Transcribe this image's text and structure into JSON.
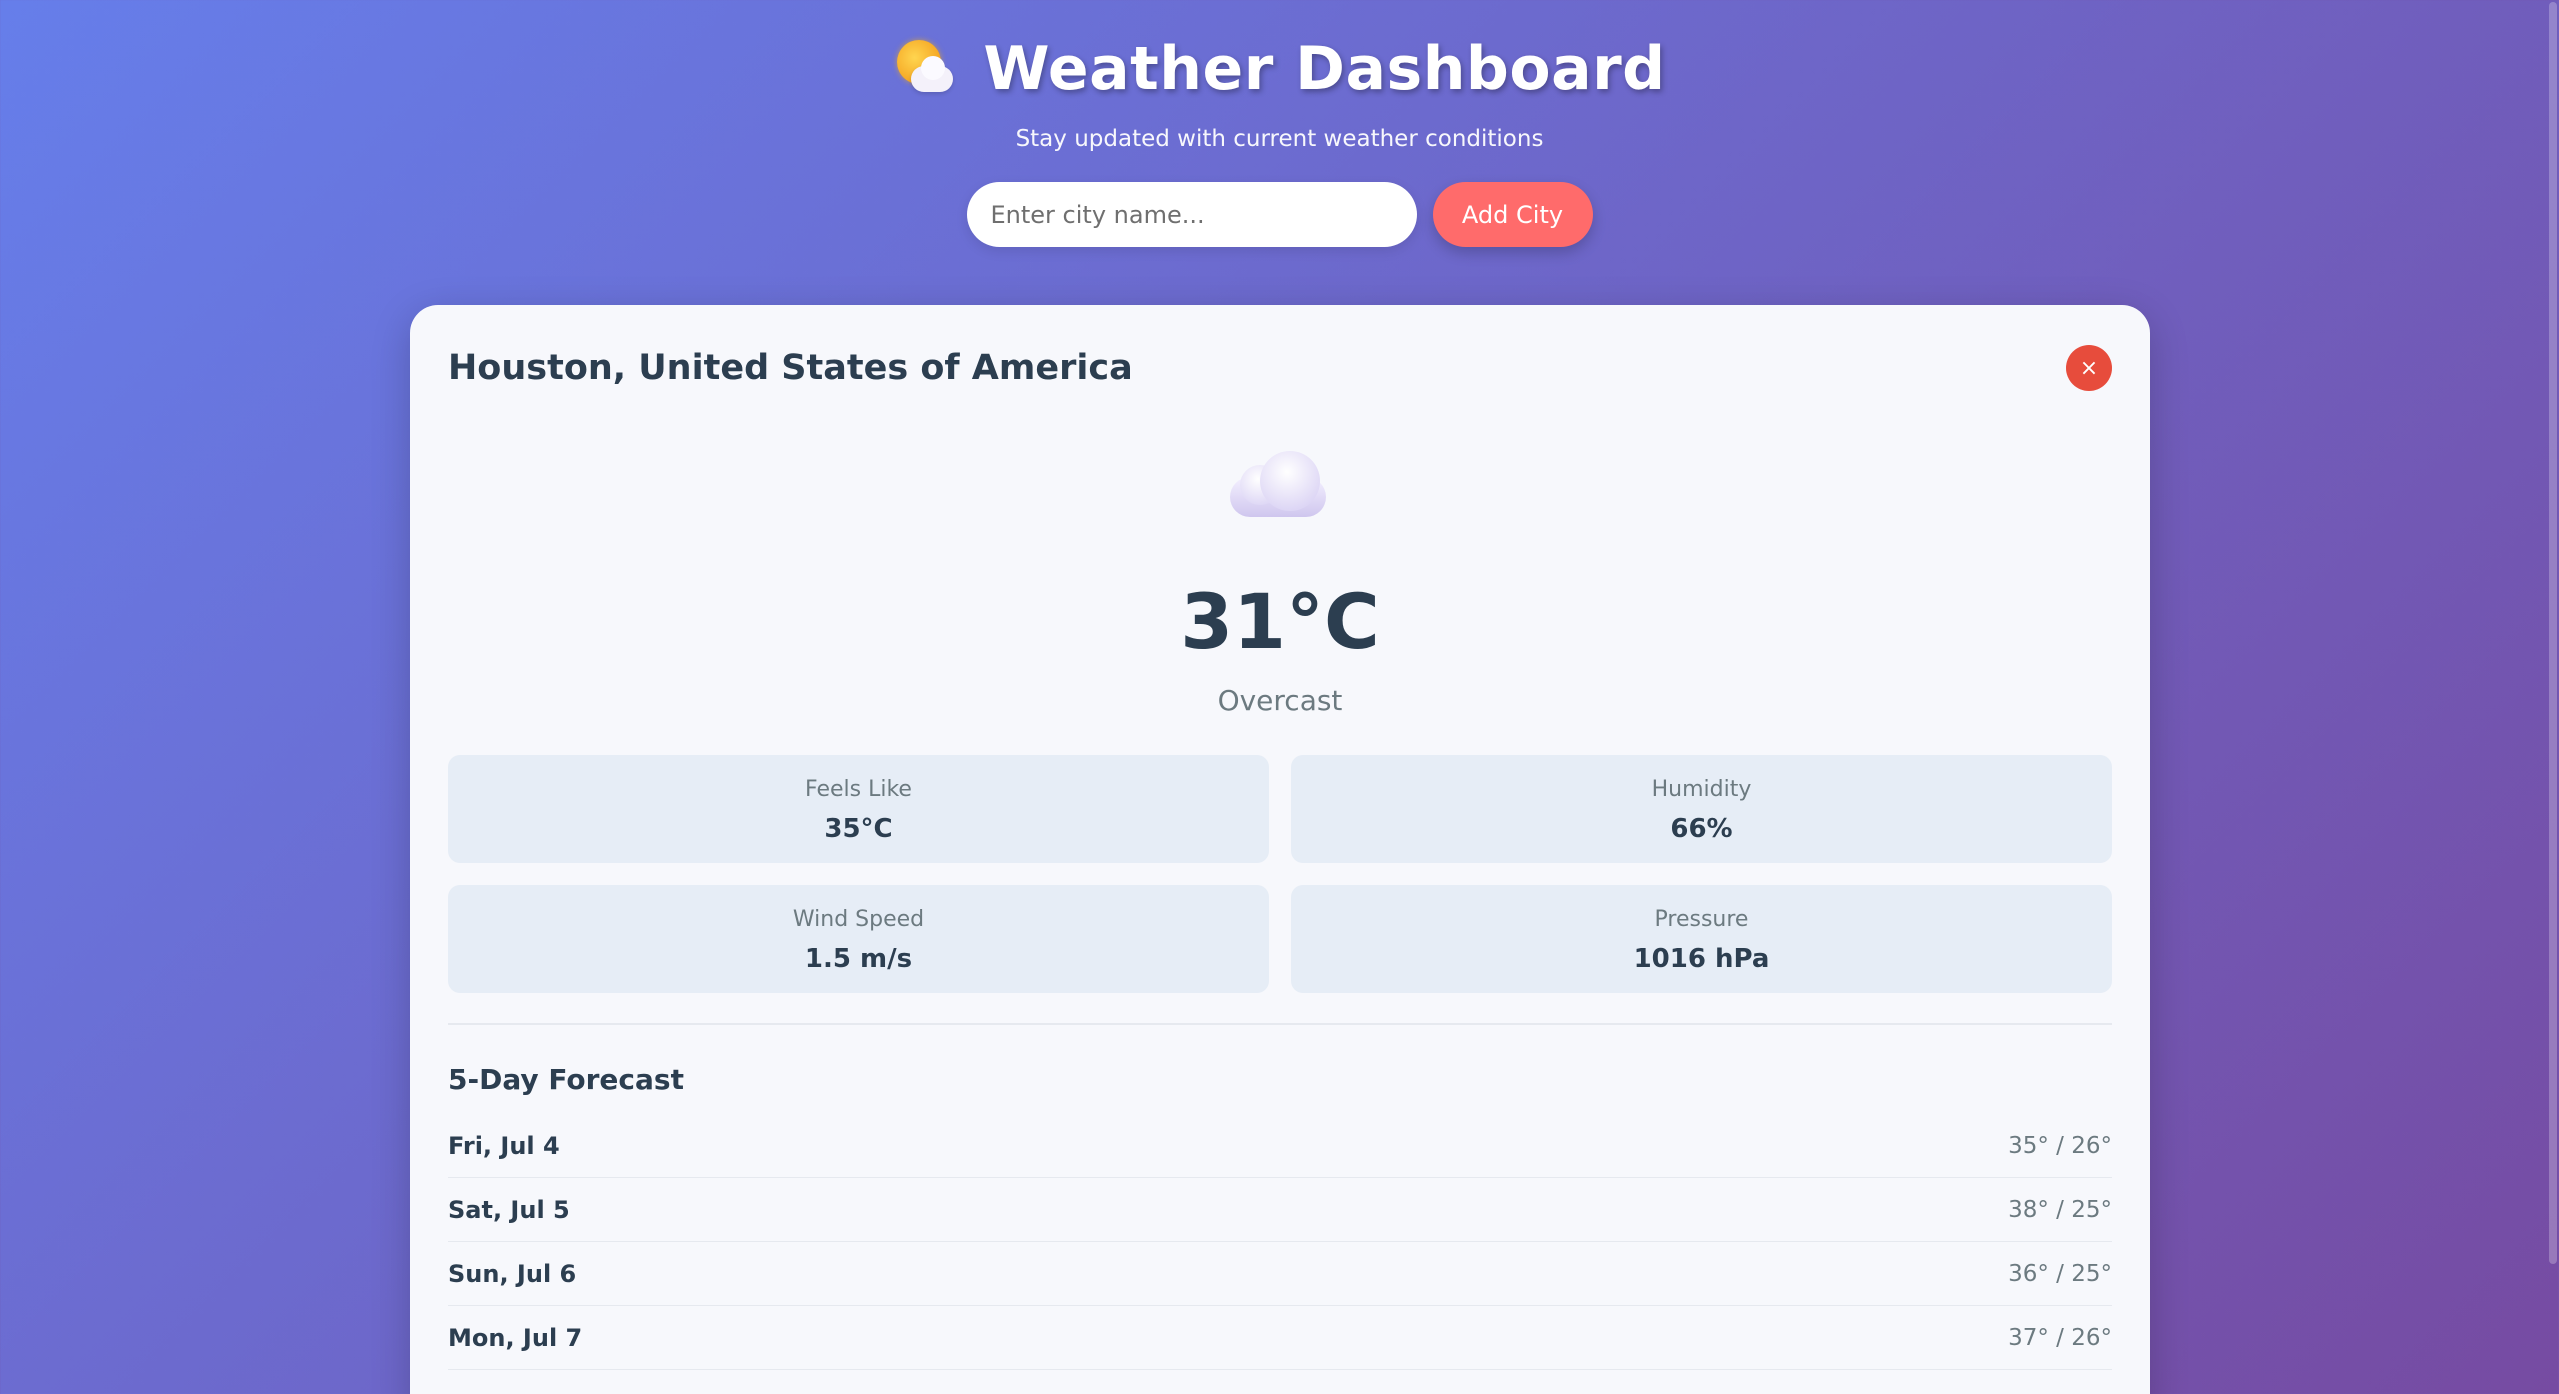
{
  "header": {
    "title": "Weather Dashboard",
    "subtitle": "Stay updated with current weather conditions",
    "logo_icon": "sun-behind-cloud-icon"
  },
  "search": {
    "placeholder": "Enter city name...",
    "value": "",
    "add_button_label": "Add City"
  },
  "card": {
    "city": "Houston, United States of America",
    "remove_label": "×",
    "weather_icon": "cloud-icon",
    "temperature": "31°C",
    "condition": "Overcast",
    "details": [
      {
        "label": "Feels Like",
        "value": "35°C"
      },
      {
        "label": "Humidity",
        "value": "66%"
      },
      {
        "label": "Wind Speed",
        "value": "1.5 m/s"
      },
      {
        "label": "Pressure",
        "value": "1016 hPa"
      }
    ],
    "forecast_title": "5-Day Forecast",
    "forecast": [
      {
        "day": "Fri, Jul 4",
        "temps": "35° / 26°"
      },
      {
        "day": "Sat, Jul 5",
        "temps": "38° / 25°"
      },
      {
        "day": "Sun, Jul 6",
        "temps": "36° / 25°"
      },
      {
        "day": "Mon, Jul 7",
        "temps": "37° / 26°"
      }
    ]
  },
  "colors": {
    "gradient_start": "#667eea",
    "gradient_end": "#764ba2",
    "accent": "#ff6b6b",
    "remove": "#e74c3c",
    "text_dark": "#2c3e50"
  }
}
